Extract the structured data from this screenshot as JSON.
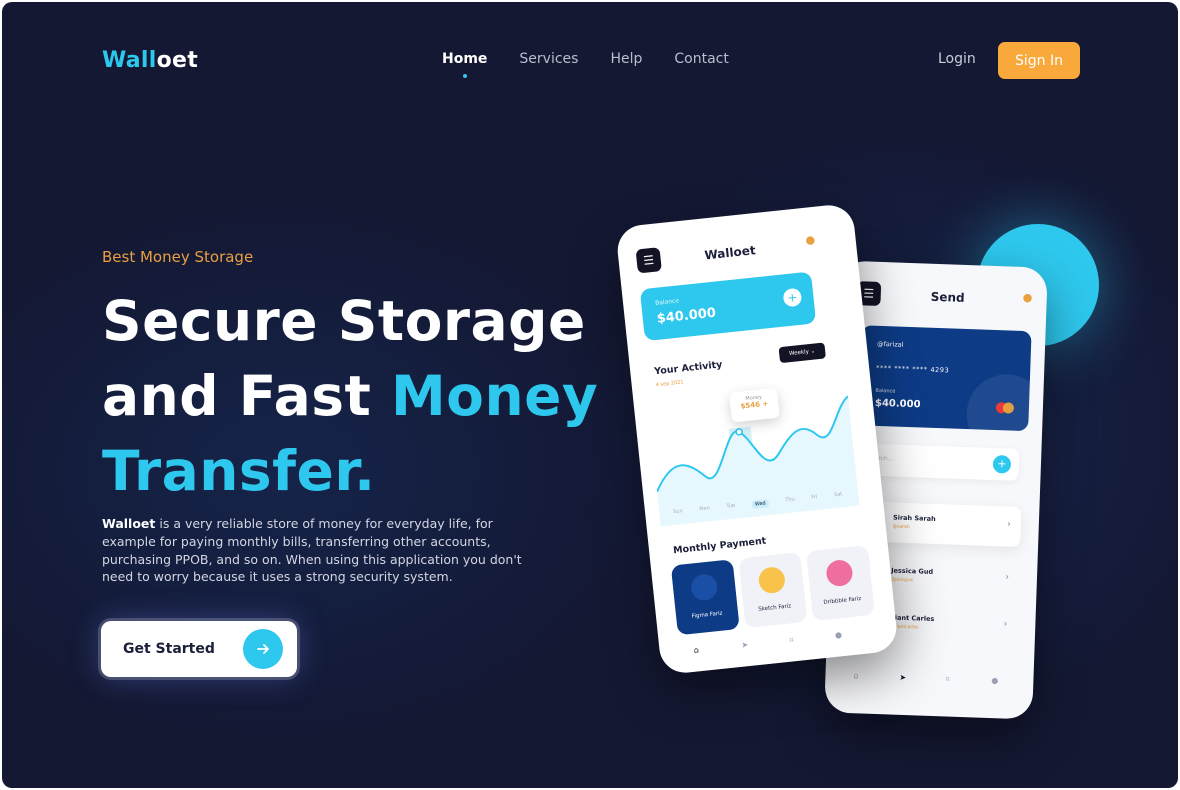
{
  "brand": {
    "logo_accent": "Wall",
    "logo_rest": "oet"
  },
  "nav": {
    "items": [
      {
        "label": "Home",
        "active": true
      },
      {
        "label": "Services",
        "active": false
      },
      {
        "label": "Help",
        "active": false
      },
      {
        "label": "Contact",
        "active": false
      }
    ],
    "login_label": "Login",
    "signin_label": "Sign In"
  },
  "hero": {
    "eyebrow": "Best Money Storage",
    "headline_1": "Secure Storage",
    "headline_2a": "and Fast ",
    "headline_2b": "Money",
    "headline_3": "Transfer.",
    "desc_bold": "Walloet",
    "desc_rest": " is a very reliable store of money for everyday life, for example for paying monthly bills, transferring other accounts, purchasing PPOB, and so on. When using this application you don't need to worry because it uses a strong security system.",
    "cta_label": "Get Started"
  },
  "phone_home": {
    "title": "Walloet",
    "balance_label": "Balance",
    "balance_value": "$40.000",
    "activity_title": "Your Activity",
    "activity_date": "4 sep 2021",
    "filter": "Weekly",
    "tooltip_label": "Money",
    "tooltip_value": "$546 +",
    "days": [
      "Sun",
      "Mon",
      "Tue",
      "Wed",
      "Thu",
      "Fri",
      "Sat"
    ],
    "selected_day": "Wed",
    "monthly_title": "Monthly Payment",
    "payments": [
      {
        "label": "Figma Fariz"
      },
      {
        "label": "Sketch Fariz"
      },
      {
        "label": "Dribbble Fariz"
      }
    ]
  },
  "phone_send": {
    "title": "Send",
    "card_user": "@farizal",
    "card_number": "**** **** **** 4293",
    "card_balance_label": "Balance",
    "card_balance": "$40.000",
    "search_placeholder": "Search...",
    "contacts": [
      {
        "name": "Sirah Sarah",
        "handle": "@sarah"
      },
      {
        "name": "Jessica Gud",
        "handle": "@jessgud"
      },
      {
        "name": "Giant Carles",
        "handle": "@giantcarles"
      }
    ]
  },
  "colors": {
    "background": "#141833",
    "accent_cyan": "#2ec8ee",
    "accent_orange": "#f9a83b",
    "card_blue": "#0d3b86"
  },
  "icons": {
    "cta": "arrow-right-icon",
    "menu": "menu-icon",
    "bell": "bell-icon",
    "plus": "plus-icon",
    "chevron": "chevron-right-icon"
  }
}
